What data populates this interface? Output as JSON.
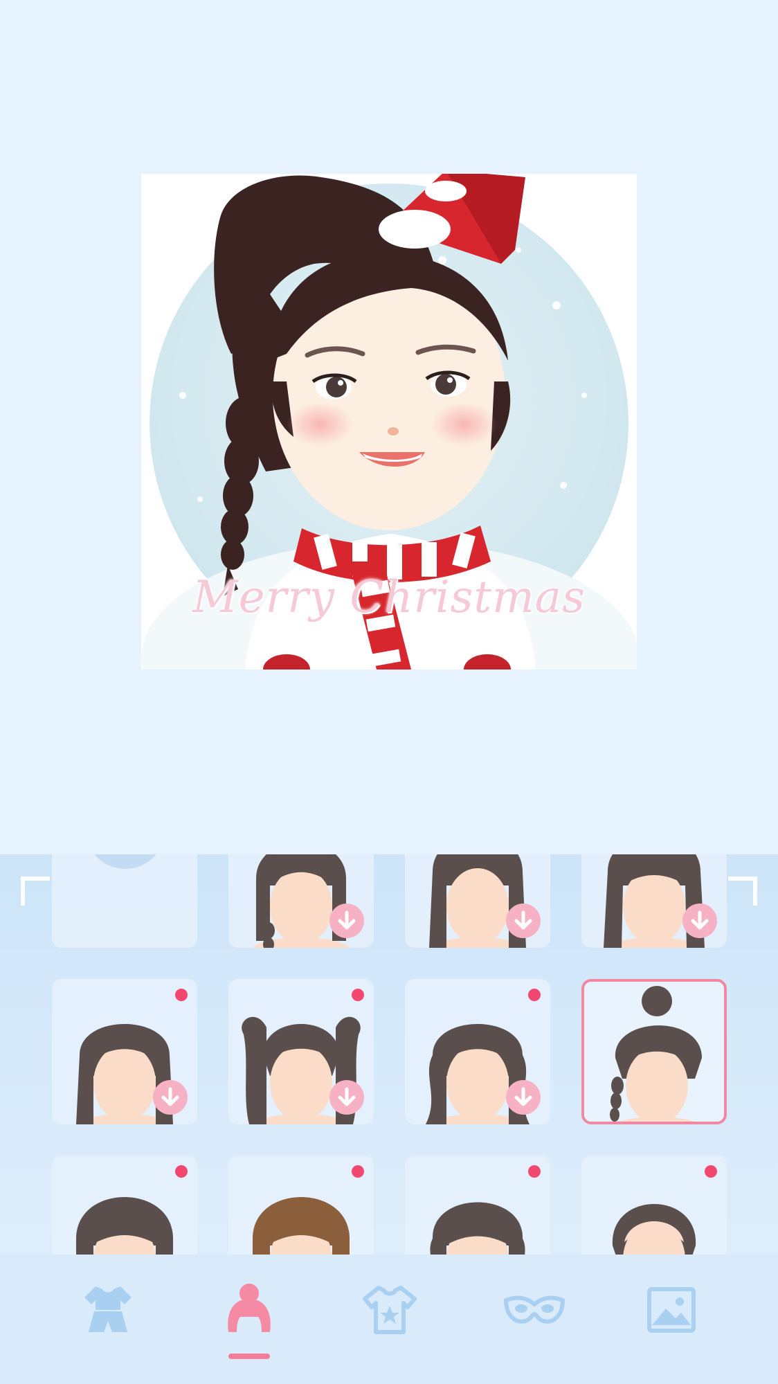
{
  "preview": {
    "greeting": "Merry Christmas"
  },
  "picker": {
    "category": "hairstyle",
    "selected_index": 7,
    "items": [
      {
        "type": "none",
        "icon": "bun-silhouette-icon",
        "hair_color": "#ffffff",
        "style": "bun",
        "new": false,
        "download": false
      },
      {
        "type": "hair",
        "style": "bangs-braid",
        "hair_color": "#5a4f4d",
        "new": false,
        "download": true
      },
      {
        "type": "hair",
        "style": "side-bangs-long",
        "hair_color": "#5a4f4d",
        "new": false,
        "download": true
      },
      {
        "type": "hair",
        "style": "bangs-long",
        "hair_color": "#5a4f4d",
        "new": false,
        "download": true
      },
      {
        "type": "hair",
        "style": "long-straight",
        "hair_color": "#5a4f4d",
        "new": true,
        "download": true
      },
      {
        "type": "hair",
        "style": "twin-tails",
        "hair_color": "#5a4f4d",
        "new": true,
        "download": true
      },
      {
        "type": "hair",
        "style": "long-wavy",
        "hair_color": "#5a4f4d",
        "new": true,
        "download": true
      },
      {
        "type": "hair",
        "style": "messy-bun-braid",
        "hair_color": "#5a4f4d",
        "new": false,
        "download": false
      },
      {
        "type": "hair",
        "style": "bob-bangs",
        "hair_color": "#5a4f4d",
        "new": true,
        "download": false
      },
      {
        "type": "hair",
        "style": "bob-bangs-brown",
        "hair_color": "#8b5e3c",
        "new": true,
        "download": false
      },
      {
        "type": "hair",
        "style": "curly-bangs",
        "hair_color": "#5a4f4d",
        "new": true,
        "download": false
      },
      {
        "type": "hair",
        "style": "short-pulled-back",
        "hair_color": "#5a4f4d",
        "new": true,
        "download": false
      }
    ]
  },
  "tabs": [
    {
      "icon": "outfit-icon",
      "active": false
    },
    {
      "icon": "hair-icon",
      "active": true
    },
    {
      "icon": "shirt-star-icon",
      "active": false
    },
    {
      "icon": "mask-icon",
      "active": false
    },
    {
      "icon": "image-icon",
      "active": false
    }
  ],
  "colors": {
    "accent": "#f27e9c",
    "new_dot": "#f2476e",
    "background": "#e6f2fd",
    "inactive_icon": "#a9d0f0"
  }
}
